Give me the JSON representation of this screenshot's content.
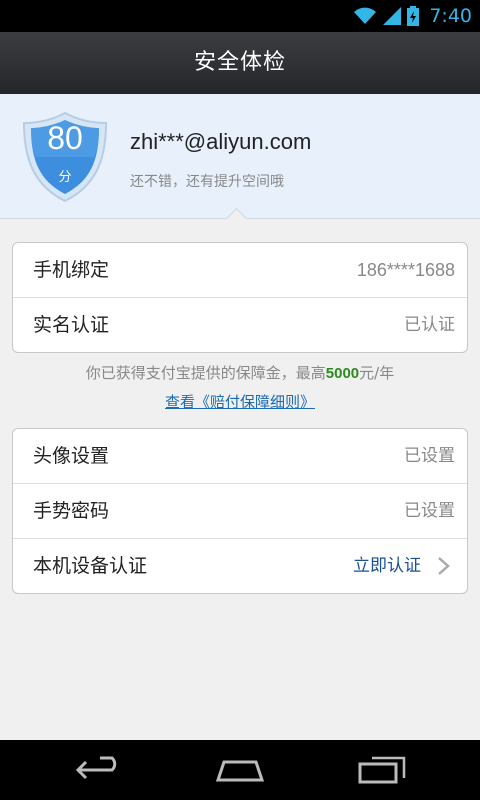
{
  "status_bar": {
    "time": "7:40",
    "icons": [
      "wifi-icon",
      "signal-icon",
      "battery-icon"
    ]
  },
  "header": {
    "title": "安全体检"
  },
  "profile": {
    "score": "80",
    "score_unit": "分",
    "email": "zhi***@aliyun.com",
    "message": "还不错，还有提升空间哦"
  },
  "card1": {
    "rows": [
      {
        "label": "手机绑定",
        "value": "186****1688"
      },
      {
        "label": "实名认证",
        "value": "已认证"
      }
    ]
  },
  "guarantee": {
    "prefix": "你已获得支付宝提供的保障金，最高",
    "amount": "5000",
    "suffix": "元/年",
    "link": "查看《赔付保障细则》"
  },
  "card2": {
    "rows": [
      {
        "label": "头像设置",
        "value": "已设置"
      },
      {
        "label": "手势密码",
        "value": "已设置"
      },
      {
        "label": "本机设备认证",
        "value": "立即认证"
      }
    ]
  },
  "nav": {
    "icons": [
      "back-icon",
      "home-icon",
      "recent-apps-icon"
    ]
  },
  "colors": {
    "accent": "#33b5e5",
    "shield": "#3d8ede",
    "link": "#1a4f9a",
    "amount": "#2e8b1e"
  }
}
